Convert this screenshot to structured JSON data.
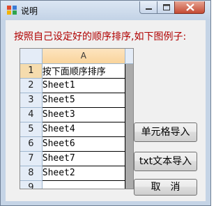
{
  "window": {
    "title": "说明",
    "controls": {
      "minimize_icon": "minimize-icon",
      "maximize_icon": "maximize-icon",
      "close_icon": "close-icon"
    }
  },
  "instruction": "按照自己设定好的顺序排序,如下图例子:",
  "sheet": {
    "column_header": "A",
    "rows": [
      {
        "num": "1",
        "value": "按下面顺序排序"
      },
      {
        "num": "2",
        "value": "Sheet1"
      },
      {
        "num": "3",
        "value": "Sheet5"
      },
      {
        "num": "4",
        "value": "Sheet3"
      },
      {
        "num": "5",
        "value": "Sheet4"
      },
      {
        "num": "6",
        "value": "Sheet6"
      },
      {
        "num": "7",
        "value": "Sheet7"
      },
      {
        "num": "8",
        "value": "Sheet2"
      },
      {
        "num": "9",
        "value": ""
      }
    ]
  },
  "buttons": {
    "cell_import": "单元格导入",
    "txt_import": "txt文本导入",
    "cancel": "取　消"
  },
  "colors": {
    "instruction": "#b00000",
    "column_header_bg": "#f9d49c",
    "row_header_bg": "#e4ecf7"
  }
}
